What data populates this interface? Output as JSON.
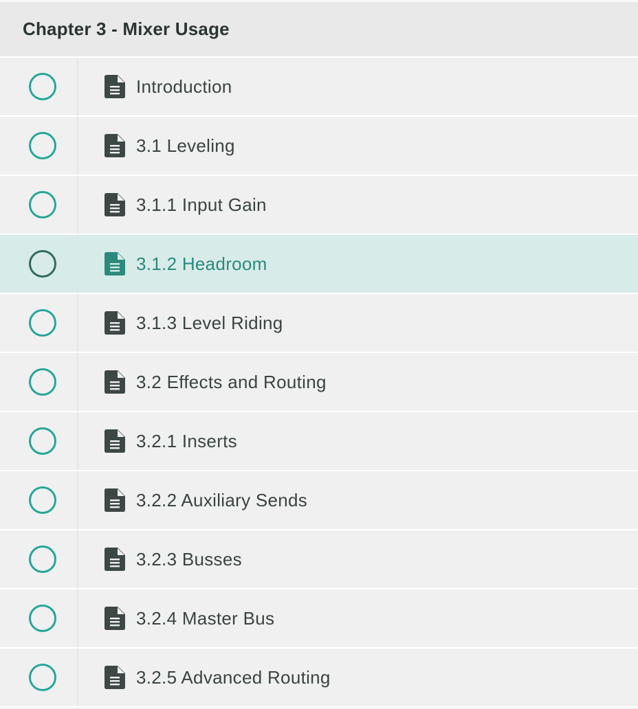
{
  "chapter": {
    "title": "Chapter 3 - Mixer Usage"
  },
  "colors": {
    "accent": "#26a69a",
    "active_row_bg": "#d7ebe8",
    "active_text": "#2b8a7c",
    "icon": "#3d4846"
  },
  "lectures": [
    {
      "title": "Introduction",
      "icon": "document-icon",
      "completed": false,
      "active": false
    },
    {
      "title": "3.1 Leveling",
      "icon": "document-icon",
      "completed": false,
      "active": false
    },
    {
      "title": "3.1.1 Input Gain",
      "icon": "document-icon",
      "completed": false,
      "active": false
    },
    {
      "title": "3.1.2 Headroom",
      "icon": "document-icon",
      "completed": false,
      "active": true
    },
    {
      "title": "3.1.3 Level Riding",
      "icon": "document-icon",
      "completed": false,
      "active": false
    },
    {
      "title": "3.2 Effects and Routing",
      "icon": "document-icon",
      "completed": false,
      "active": false
    },
    {
      "title": "3.2.1 Inserts",
      "icon": "document-icon",
      "completed": false,
      "active": false
    },
    {
      "title": "3.2.2 Auxiliary Sends",
      "icon": "document-icon",
      "completed": false,
      "active": false
    },
    {
      "title": "3.2.3 Busses",
      "icon": "document-icon",
      "completed": false,
      "active": false
    },
    {
      "title": "3.2.4 Master Bus",
      "icon": "document-icon",
      "completed": false,
      "active": false
    },
    {
      "title": "3.2.5 Advanced Routing",
      "icon": "document-icon",
      "completed": false,
      "active": false
    }
  ]
}
